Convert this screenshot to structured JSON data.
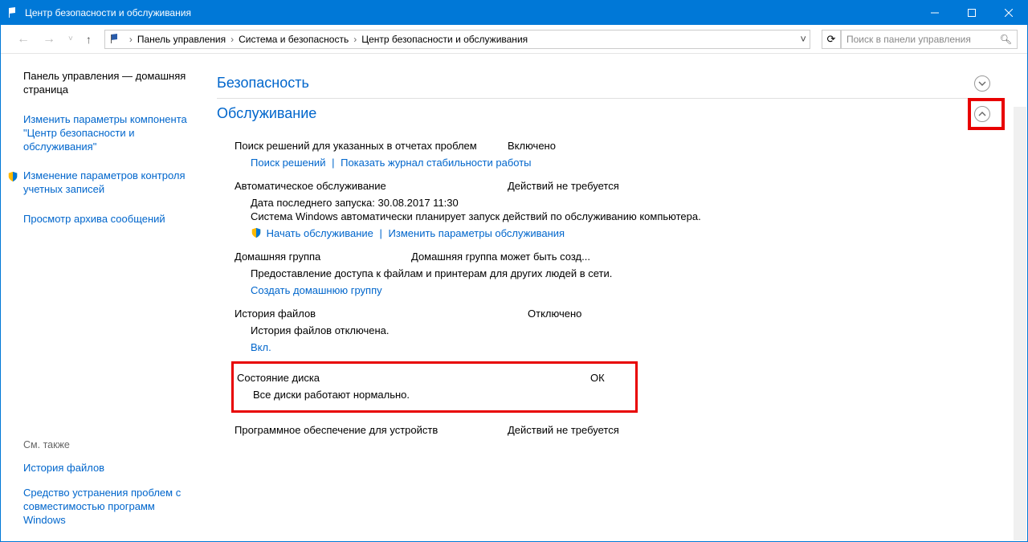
{
  "window": {
    "title": "Центр безопасности и обслуживания"
  },
  "breadcrumb": {
    "root": "Панель управления",
    "cat": "Система и безопасность",
    "page": "Центр безопасности и обслуживания"
  },
  "search": {
    "placeholder": "Поиск в панели управления"
  },
  "sidebar": {
    "home": "Панель управления — домашняя страница",
    "link1": "Изменить параметры компонента \"Центр безопасности и обслуживания\"",
    "link2": "Изменение параметров контроля учетных записей",
    "link3": "Просмотр архива сообщений",
    "seeAlso": "См. также",
    "see1": "История файлов",
    "see2": "Средство устранения проблем с совместимостью программ Windows"
  },
  "sections": {
    "security": "Безопасность",
    "maintenance": "Обслуживание"
  },
  "maint": {
    "problemReports": {
      "label": "Поиск решений для указанных в отчетах проблем",
      "status": "Включено",
      "link1": "Поиск решений",
      "link2": "Показать журнал стабильности работы"
    },
    "auto": {
      "label": "Автоматическое обслуживание",
      "status": "Действий не требуется",
      "detail1": "Дата последнего запуска: 30.08.2017 11:30",
      "detail2": "Система Windows автоматически планирует запуск действий по обслуживанию компьютера.",
      "link1": "Начать обслуживание",
      "link2": "Изменить параметры обслуживания"
    },
    "homegroup": {
      "label": "Домашняя группа",
      "status": "Домашняя группа может быть созд...",
      "detail": "Предоставление доступа к файлам и принтерам для других людей в сети.",
      "link": "Создать домашнюю группу"
    },
    "fileHistory": {
      "label": "История файлов",
      "status": "Отключено",
      "detail": "История файлов отключена.",
      "link": "Вкл."
    },
    "disk": {
      "label": "Состояние диска",
      "status": "ОК",
      "detail": "Все диски работают нормально."
    },
    "devices": {
      "label": "Программное обеспечение для устройств",
      "status": "Действий не требуется"
    }
  }
}
